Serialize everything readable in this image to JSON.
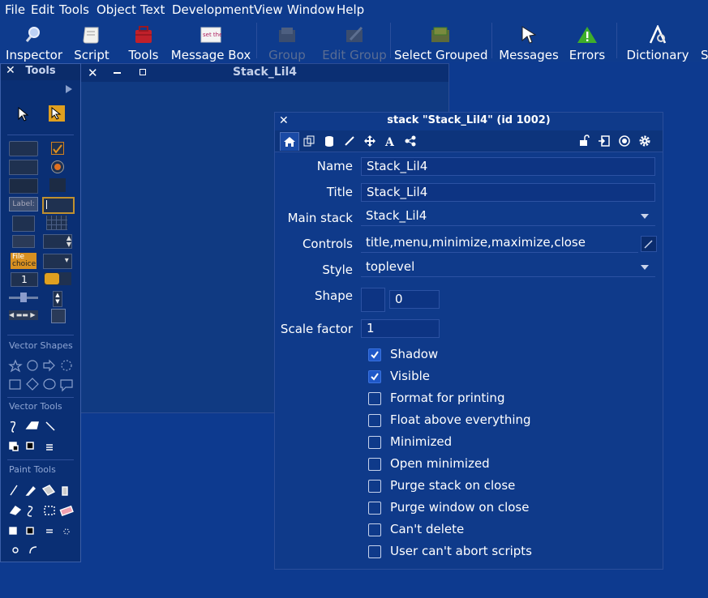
{
  "menubar": {
    "items": [
      "File",
      "Edit",
      "Tools",
      "Object",
      "Text",
      "Development",
      "View",
      "Window",
      "Help"
    ]
  },
  "toolbar": {
    "buttons": [
      {
        "label": "Inspector",
        "icon": "magnifier-icon",
        "enabled": true
      },
      {
        "label": "Script",
        "icon": "scroll-icon",
        "enabled": true
      },
      {
        "label": "Tools",
        "icon": "toolbox-icon",
        "enabled": true
      },
      {
        "label": "Message Box",
        "icon": "message-box-icon",
        "enabled": true
      },
      {
        "label": "Group",
        "icon": "group-icon",
        "enabled": false
      },
      {
        "label": "Edit Group",
        "icon": "edit-group-icon",
        "enabled": false
      },
      {
        "label": "Select Grouped",
        "icon": "select-grouped-icon",
        "enabled": true
      },
      {
        "label": "Messages",
        "icon": "cursor-icon",
        "enabled": true
      },
      {
        "label": "Errors",
        "icon": "warning-icon",
        "enabled": true
      },
      {
        "label": "Dictionary",
        "icon": "dictionary-icon",
        "enabled": true
      },
      {
        "label": "S",
        "icon": "",
        "enabled": true
      }
    ]
  },
  "tools_palette": {
    "title": "Tools",
    "sections": {
      "vector_shapes": "Vector Shapes",
      "vector_tools": "Vector Tools",
      "paint_tools": "Paint Tools"
    },
    "widget_labels": {
      "label_field": "Label:",
      "file_choice_top": "File",
      "file_choice_bottom": "choice",
      "numeric": "1"
    }
  },
  "stack_window": {
    "title": "Stack_Lil4"
  },
  "inspector": {
    "title": "stack \"Stack_Lil4\" (id 1002)",
    "fields": {
      "name_label": "Name",
      "name_value": "Stack_Lil4",
      "title_label": "Title",
      "title_value": "Stack_Lil4",
      "mainstack_label": "Main stack",
      "mainstack_value": "Stack_Lil4",
      "controls_label": "Controls",
      "controls_value": "title,menu,minimize,maximize,close",
      "style_label": "Style",
      "style_value": "toplevel",
      "shape_label": "Shape",
      "shape_value": "0",
      "scale_label": "Scale factor",
      "scale_value": "1"
    },
    "checkboxes": [
      {
        "label": "Shadow",
        "checked": true
      },
      {
        "label": "Visible",
        "checked": true
      },
      {
        "label": "Format for printing",
        "checked": false
      },
      {
        "label": "Float above everything",
        "checked": false
      },
      {
        "label": "Minimized",
        "checked": false
      },
      {
        "label": "Open minimized",
        "checked": false
      },
      {
        "label": "Purge stack on close",
        "checked": false
      },
      {
        "label": "Purge window on close",
        "checked": false
      },
      {
        "label": "Can't delete",
        "checked": false
      },
      {
        "label": "User can't abort scripts",
        "checked": false
      }
    ]
  },
  "colors": {
    "desktop": "#0d3a8f",
    "accent_check": "#1f58c8",
    "warning": "#3fae2a",
    "toolbox_red": "#c0202a",
    "tool_orange": "#e0a020"
  }
}
